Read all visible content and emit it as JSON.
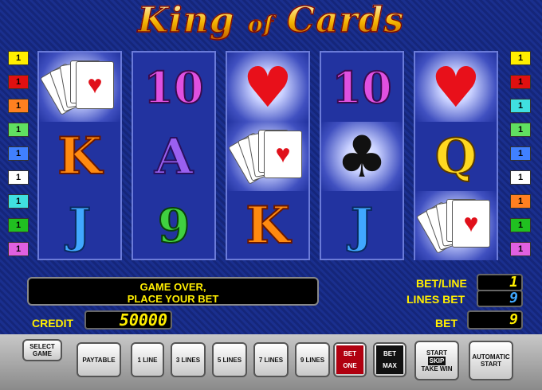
{
  "title": {
    "main": "King",
    "of": "of",
    "end": "Cards"
  },
  "line_colors": [
    "#ffee00",
    "#e01010",
    "#ff8020",
    "#60e060",
    "#4080ff",
    "#ffffff",
    "#40e0e0",
    "#20c020",
    "#e060e0"
  ],
  "right_colors": [
    "#ffee00",
    "#e01010",
    "#40e0e0",
    "#60e060",
    "#4080ff",
    "#ffffff",
    "#ff8020",
    "#20c020",
    "#e060e0"
  ],
  "line_label": "1",
  "reels": [
    [
      "cards-fan",
      "K",
      "J"
    ],
    [
      "10",
      "A",
      "9"
    ],
    [
      "heart",
      "cards-fan",
      "K"
    ],
    [
      "10",
      "club",
      "J"
    ],
    [
      "heart",
      "Q",
      "cards-fan"
    ]
  ],
  "message": {
    "line1": "GAME OVER,",
    "line2": "PLACE YOUR BET"
  },
  "bet_line": {
    "label": "BET/LINE",
    "value": "1"
  },
  "lines_bet": {
    "label": "LINES BET",
    "value": "9"
  },
  "credit": {
    "label": "CREDIT",
    "value": "50000"
  },
  "bet": {
    "label": "BET",
    "value": "9"
  },
  "buttons": {
    "select_game": [
      "SELECT",
      "GAME"
    ],
    "paytable": "PAYTABLE",
    "line1": "1 LINE",
    "line3": "3 LINES",
    "line5": "5 LINES",
    "line7": "7 LINES",
    "line9": "9 LINES",
    "bet_one": [
      "BET",
      "ONE"
    ],
    "bet_max": [
      "BET",
      "MAX"
    ],
    "start": [
      "START",
      "SKIP",
      "TAKE WIN"
    ],
    "auto": [
      "AUTOMATIC",
      "START"
    ]
  }
}
